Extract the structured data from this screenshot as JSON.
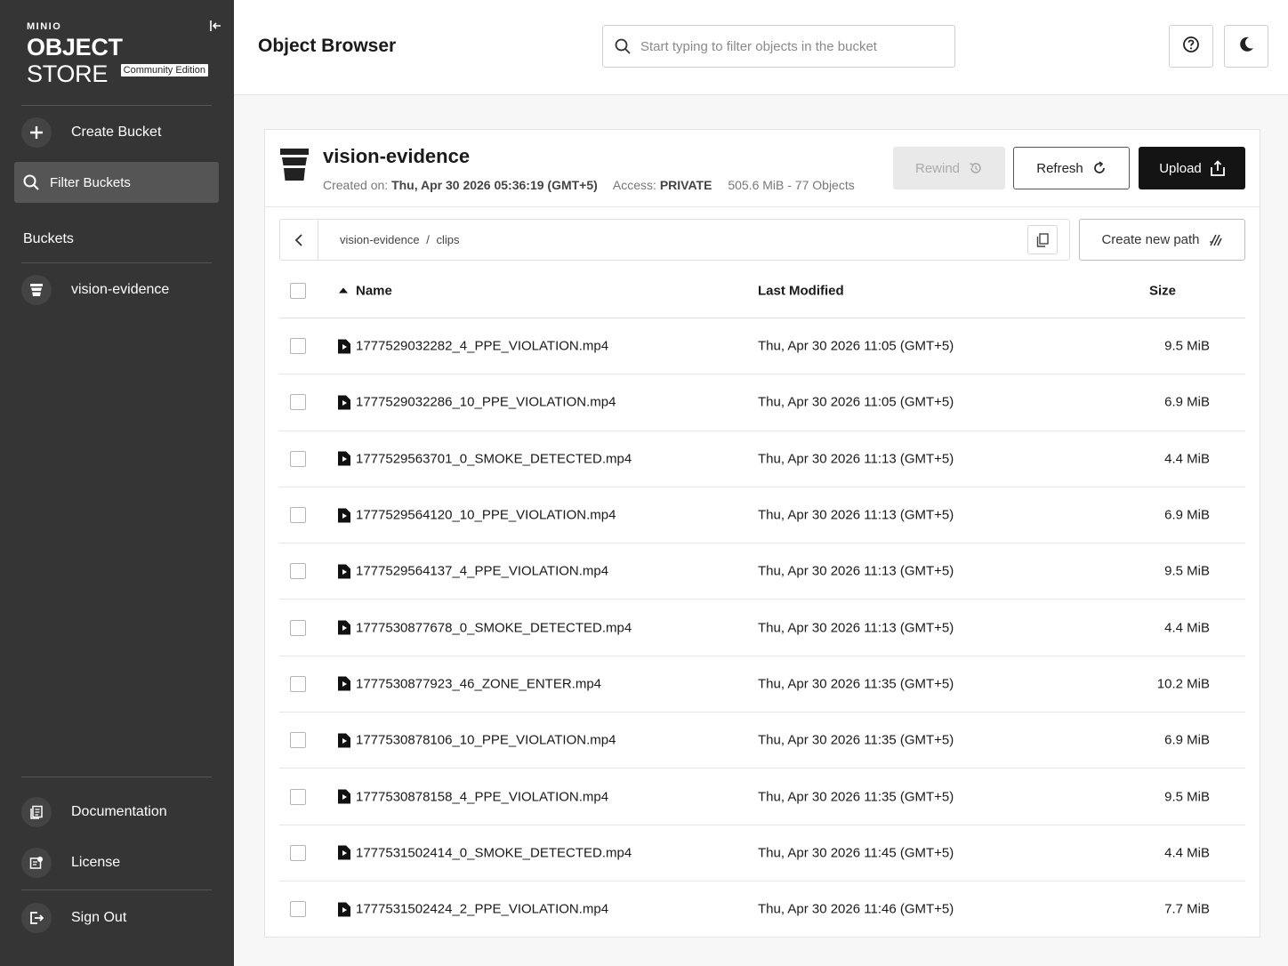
{
  "sidebar": {
    "logo_top": "MINIO",
    "logo_main_bold": "OBJECT",
    "logo_main_light": " STORE",
    "edition": "Community Edition",
    "create_bucket": "Create Bucket",
    "filter_buckets": "Filter Buckets",
    "buckets_heading": "Buckets",
    "bucket_items": [
      "vision-evidence"
    ],
    "documentation": "Documentation",
    "license": "License",
    "sign_out": "Sign Out"
  },
  "header": {
    "title": "Object Browser",
    "search_placeholder": "Start typing to filter objects in the bucket"
  },
  "bucket": {
    "name": "vision-evidence",
    "created_label": "Created on: ",
    "created_value": "Thu, Apr 30 2026 05:36:19 (GMT+5)",
    "access_label": "Access: ",
    "access_value": "PRIVATE",
    "usage": "505.6 MiB - 77 Objects",
    "rewind": "Rewind",
    "refresh": "Refresh",
    "upload": "Upload"
  },
  "path": {
    "root": "vision-evidence",
    "separator": "/",
    "current": "clips",
    "create_new_path": "Create new path"
  },
  "table": {
    "headers": {
      "name": "Name",
      "modified": "Last Modified",
      "size": "Size"
    },
    "rows": [
      {
        "name": "1777529032282_4_PPE_VIOLATION.mp4",
        "modified": "Thu, Apr 30 2026 11:05 (GMT+5)",
        "size": "9.5 MiB"
      },
      {
        "name": "1777529032286_10_PPE_VIOLATION.mp4",
        "modified": "Thu, Apr 30 2026 11:05 (GMT+5)",
        "size": "6.9 MiB"
      },
      {
        "name": "1777529563701_0_SMOKE_DETECTED.mp4",
        "modified": "Thu, Apr 30 2026 11:13 (GMT+5)",
        "size": "4.4 MiB"
      },
      {
        "name": "1777529564120_10_PPE_VIOLATION.mp4",
        "modified": "Thu, Apr 30 2026 11:13 (GMT+5)",
        "size": "6.9 MiB"
      },
      {
        "name": "1777529564137_4_PPE_VIOLATION.mp4",
        "modified": "Thu, Apr 30 2026 11:13 (GMT+5)",
        "size": "9.5 MiB"
      },
      {
        "name": "1777530877678_0_SMOKE_DETECTED.mp4",
        "modified": "Thu, Apr 30 2026 11:13 (GMT+5)",
        "size": "4.4 MiB"
      },
      {
        "name": "1777530877923_46_ZONE_ENTER.mp4",
        "modified": "Thu, Apr 30 2026 11:35 (GMT+5)",
        "size": "10.2 MiB"
      },
      {
        "name": "1777530878106_10_PPE_VIOLATION.mp4",
        "modified": "Thu, Apr 30 2026 11:35 (GMT+5)",
        "size": "6.9 MiB"
      },
      {
        "name": "1777530878158_4_PPE_VIOLATION.mp4",
        "modified": "Thu, Apr 30 2026 11:35 (GMT+5)",
        "size": "9.5 MiB"
      },
      {
        "name": "1777531502414_0_SMOKE_DETECTED.mp4",
        "modified": "Thu, Apr 30 2026 11:45 (GMT+5)",
        "size": "4.4 MiB"
      },
      {
        "name": "1777531502424_2_PPE_VIOLATION.mp4",
        "modified": "Thu, Apr 30 2026 11:46 (GMT+5)",
        "size": "7.7 MiB"
      }
    ]
  },
  "icons": {
    "create_bucket": "plus-icon",
    "filter": "search-icon",
    "bucket": "bucket-icon",
    "documentation": "document-icon",
    "license": "license-icon",
    "sign_out": "sign-out-icon",
    "help": "help-icon",
    "theme": "moon-icon",
    "file": "video-file-icon"
  }
}
